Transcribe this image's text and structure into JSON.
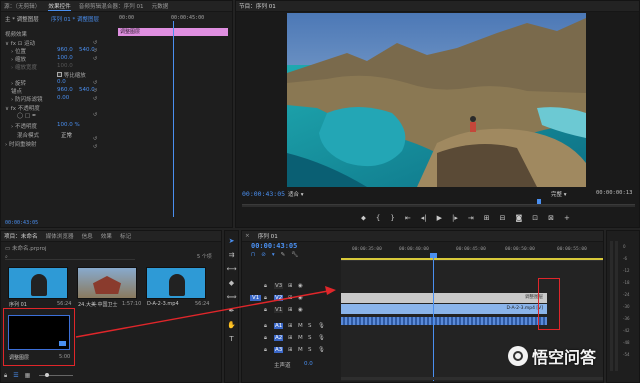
{
  "effect_controls": {
    "tabs": [
      "源：（无剪辑）",
      "效果控件",
      "音频剪辑混合器：序列 01",
      "元数据"
    ],
    "header_left": "主 * 调整图层",
    "header_right": "序列 01 * 调整图层",
    "mini_time_a": "00:00",
    "mini_time_b": "00:00:45:00",
    "clip_label": "调整图层",
    "section_video": "视频效果",
    "motion": "运动",
    "position_label": "位置",
    "position_x": "960.0",
    "position_y": "540.0",
    "scale_label": "缩放",
    "scale_val": "100.0",
    "scale_width_label": "缩放宽度",
    "scale_width_val": "100.0",
    "uniform_scale": "等比缩放",
    "rotation_label": "旋转",
    "rotation_val": "0.0",
    "anchor_label": "锚点",
    "anchor_x": "960.0",
    "anchor_y": "540.0",
    "flicker_label": "防闪烁滤镜",
    "flicker_val": "0.00",
    "opacity_section": "不透明度",
    "opacity_label": "不透明度",
    "opacity_val": "100.0 %",
    "blend_label": "混合模式",
    "blend_val": "正常",
    "time_remap": "时间重映射",
    "bottom_time": "00:00:43:05"
  },
  "program": {
    "title": "节目：序列 01",
    "time_left": "00:00:43:05",
    "fit": "适合",
    "quality": "完整",
    "time_right": "00:00:00:13"
  },
  "project": {
    "tabs": [
      "项目：未命名",
      "媒体浏览器",
      "信息",
      "效果",
      "标记"
    ],
    "path": "未命名.prproj",
    "count": "5 个项",
    "items": [
      {
        "name": "序列 01",
        "dur": "56:24"
      },
      {
        "name": "24.大美·中国卫士...",
        "dur": "1:57:10"
      },
      {
        "name": "D-A-2-3.mp4",
        "dur": "56:24"
      },
      {
        "name": "调整图层",
        "dur": "5:00"
      }
    ]
  },
  "timeline": {
    "title": "序列 01",
    "time": "00:00:43:05",
    "ruler": [
      "00:00:35:00",
      "00:00:40:00",
      "00:00:45:00",
      "00:00:50:00",
      "00:00:55:00"
    ],
    "tracks": [
      {
        "name": "V3",
        "kind": "v"
      },
      {
        "name": "V2",
        "kind": "v"
      },
      {
        "name": "V1",
        "kind": "v"
      },
      {
        "name": "A1",
        "kind": "a"
      },
      {
        "name": "A2",
        "kind": "a"
      },
      {
        "name": "A3",
        "kind": "a"
      }
    ],
    "master": "主声道",
    "master_val": "0.0",
    "clip_adjust": "调整图层",
    "clip_video": "D-A-2-3.mp4 [V]",
    "meter_labels": [
      "0",
      "-6",
      "-12",
      "-18",
      "-24",
      "-30",
      "-36",
      "-42",
      "-48",
      "-54",
      "dB"
    ]
  },
  "watermark": "悟空问答",
  "colors": {
    "accent": "#4a8ff0",
    "clip_pink": "#df8fe0",
    "red": "#e0262a"
  }
}
